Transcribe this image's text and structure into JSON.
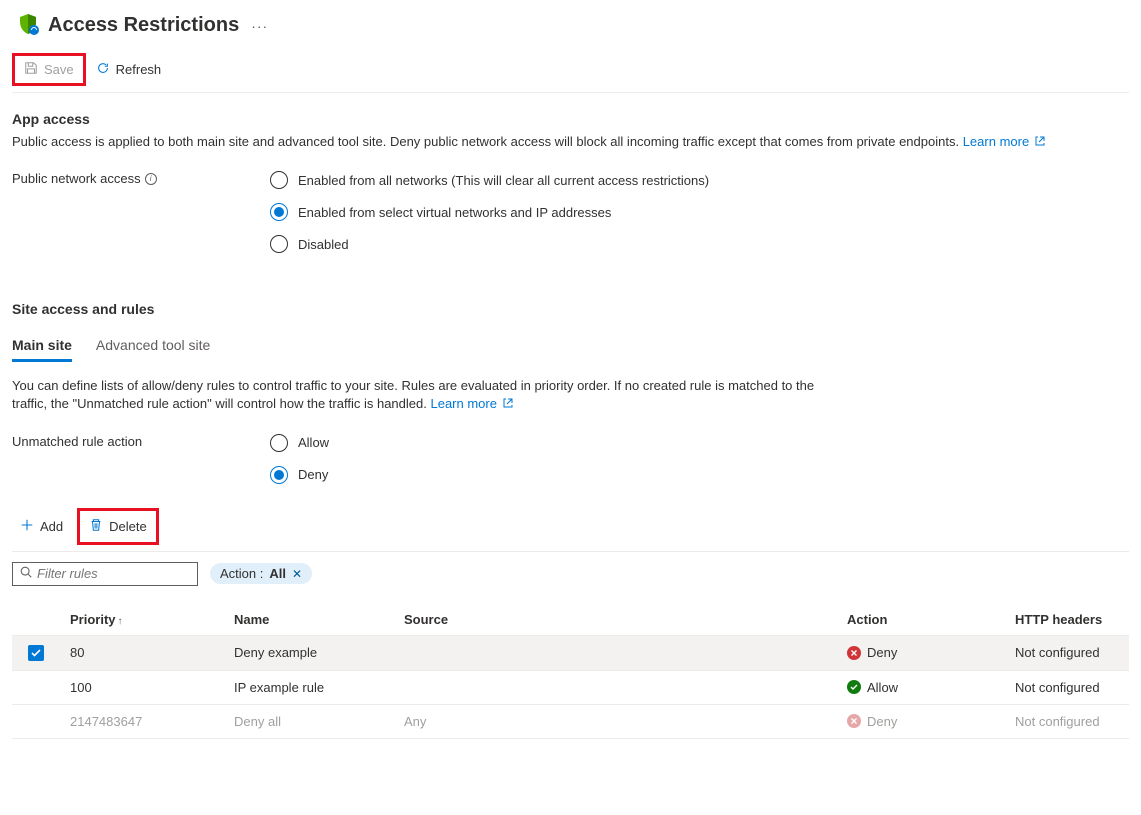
{
  "header": {
    "title": "Access Restrictions"
  },
  "toolbar": {
    "save": "Save",
    "refresh": "Refresh"
  },
  "app_access": {
    "heading": "App access",
    "description": "Public access is applied to both main site and advanced tool site. Deny public network access will block all incoming traffic except that comes from private endpoints.",
    "learn_more": "Learn more",
    "label": "Public network access",
    "options": {
      "all": "Enabled from all networks (This will clear all current access restrictions)",
      "select": "Enabled from select virtual networks and IP addresses",
      "disabled": "Disabled"
    }
  },
  "site_access": {
    "heading": "Site access and rules",
    "tabs": {
      "main": "Main site",
      "advanced": "Advanced tool site"
    },
    "description": "You can define lists of allow/deny rules to control traffic to your site. Rules are evaluated in priority order. If no created rule is matched to the traffic, the \"Unmatched rule action\" will control how the traffic is handled.",
    "learn_more": "Learn more",
    "unmatched_label": "Unmatched rule action",
    "unmatched_options": {
      "allow": "Allow",
      "deny": "Deny"
    }
  },
  "actions": {
    "add": "Add",
    "delete": "Delete"
  },
  "filter": {
    "placeholder": "Filter rules",
    "pill_key": "Action :",
    "pill_value": "All"
  },
  "table": {
    "headers": {
      "priority": "Priority",
      "name": "Name",
      "source": "Source",
      "action": "Action",
      "http": "HTTP headers"
    },
    "rows": [
      {
        "priority": "80",
        "name": "Deny example",
        "source": "",
        "action": "Deny",
        "http": "Not configured",
        "checked": true,
        "status": "deny"
      },
      {
        "priority": "100",
        "name": "IP example rule",
        "source": "",
        "action": "Allow",
        "http": "Not configured",
        "checked": false,
        "status": "allow"
      },
      {
        "priority": "2147483647",
        "name": "Deny all",
        "source": "Any",
        "action": "Deny",
        "http": "Not configured",
        "checked": false,
        "status": "deny-dim"
      }
    ]
  }
}
